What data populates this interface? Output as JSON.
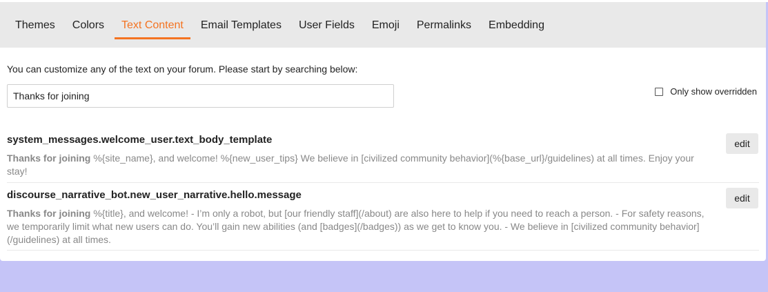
{
  "nav": {
    "tabs": [
      {
        "label": "Themes",
        "active": false
      },
      {
        "label": "Colors",
        "active": false
      },
      {
        "label": "Text Content",
        "active": true
      },
      {
        "label": "Email Templates",
        "active": false
      },
      {
        "label": "User Fields",
        "active": false
      },
      {
        "label": "Emoji",
        "active": false
      },
      {
        "label": "Permalinks",
        "active": false
      },
      {
        "label": "Embedding",
        "active": false
      }
    ]
  },
  "intro_text": "You can customize any of the text on your forum. Please start by searching below:",
  "search": {
    "value": "Thanks for joining"
  },
  "override_filter": {
    "label": "Only show overridden",
    "checked": false
  },
  "results": [
    {
      "key": "system_messages.welcome_user.text_body_template",
      "match": "Thanks for joining",
      "rest": " %{site_name}, and welcome! %{new_user_tips} We believe in [civilized community behavior](%{base_url}/guidelines) at all times. Enjoy your stay!",
      "edit_label": "edit"
    },
    {
      "key": "discourse_narrative_bot.new_user_narrative.hello.message",
      "match": "Thanks for joining",
      "rest": " %{title}, and welcome! - I’m only a robot, but [our friendly staff](/about) are also here to help if you need to reach a person. - For safety reasons, we temporarily limit what new users can do. You’ll gain new abilities (and [badges](/badges)) as we get to know you. - We believe in [civilized community behavior](/guidelines) at all times.",
      "edit_label": "edit"
    }
  ],
  "colors": {
    "accent": "#f47321",
    "nav_bg": "#e9e9e9",
    "page_bg": "#c5c4f7",
    "muted_text": "#888888"
  }
}
